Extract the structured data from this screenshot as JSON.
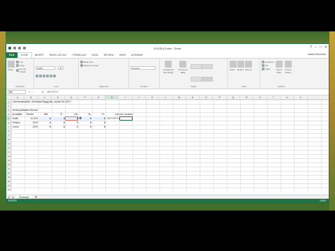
{
  "window": {
    "title": "EXCEL13.xlsx - Excel",
    "user": "Sabina Bönsdorf"
  },
  "tabs": [
    "FILE",
    "HOME",
    "INSERT",
    "PAGE LAYOUT",
    "FORMULAS",
    "DATA",
    "REVIEW",
    "VIEW",
    "ACROBAT"
  ],
  "ribbon": {
    "clipboard": {
      "cut": "Cut",
      "copy": "Copy",
      "format_painter": "Format Painter",
      "paste": "Paste",
      "label": "Clipboard"
    },
    "font": {
      "name": "Calibri",
      "size": "11",
      "label": "Font"
    },
    "alignment": {
      "wrap": "Wrap Text",
      "merge": "Merge & Center",
      "label": "Alignment"
    },
    "number": {
      "format": "General",
      "label": "Number"
    },
    "styles": {
      "conditional": "Conditional Formatting",
      "format_table": "Format as Table",
      "label": "Styles"
    },
    "cells": {
      "insert": "Insert",
      "delete": "Delete",
      "format": "Format",
      "label": "Cells"
    },
    "editing": {
      "autosum": "AutoSum",
      "fill": "Fill",
      "clear": "Clear",
      "sort": "Sort & Filter",
      "find": "Find & Select",
      "label": "Editing"
    }
  },
  "formula_bar": {
    "name_box": "H6",
    "formula": "=E7+G7+I"
  },
  "columns": [
    "A",
    "B",
    "C",
    "D",
    "E",
    "F",
    "G",
    "H",
    "I",
    "J",
    "K",
    "L",
    "M",
    "N",
    "O",
    "P",
    "Q",
    "R",
    "S",
    "T",
    "U",
    "V"
  ],
  "rows": [
    "1",
    "2",
    "3",
    "4",
    "5",
    "6",
    "7",
    "8",
    "9",
    "10",
    "11",
    "12",
    "13",
    "14",
    "15",
    "16",
    "17",
    "18",
    "19",
    "20",
    "21",
    "22"
  ],
  "cells": {
    "title": "Lönekostnader i Andreas Bygg Ab, vecka 9v 2017",
    "subtitle": "Antal jobbade timmar",
    "headers": [
      "Anställd",
      "Timlön",
      "Må",
      "Ti",
      "On",
      "To",
      "Fr",
      "Lön för veckan"
    ],
    "data": [
      {
        "name": "Kalle",
        "rate": "12,5 €",
        "ma": "8",
        "ti": "8",
        "on": "8",
        "to": "8",
        "fr": "8",
        "lon": "=E7+G7+I"
      },
      {
        "name": "Pekka",
        "rate": "15 €",
        "ma": "8",
        "ti": "8",
        "on": "0",
        "to": "8",
        "fr": "8",
        "lon": ""
      },
      {
        "name": "Lena",
        "rate": "15 €",
        "ma": "8",
        "ti": "8",
        "on": "0",
        "to": "5",
        "fr": "8",
        "lon": ""
      }
    ]
  },
  "sheet_tab": "Övning1",
  "status": {
    "mode": "ENTER",
    "zoom": "100%"
  }
}
